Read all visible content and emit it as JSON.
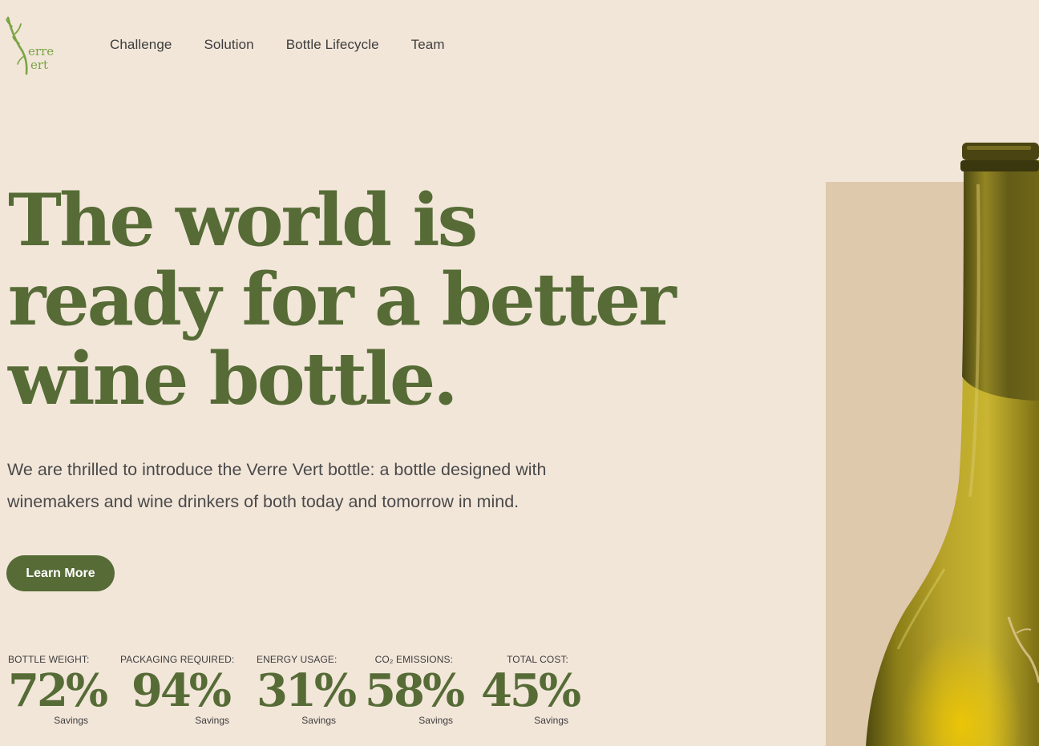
{
  "brand": {
    "name_line1": "erre",
    "name_line2": "ert",
    "accent_color": "#7aa343"
  },
  "nav": {
    "items": [
      {
        "label": "Challenge"
      },
      {
        "label": "Solution"
      },
      {
        "label": "Bottle Lifecycle"
      },
      {
        "label": "Team"
      }
    ]
  },
  "hero": {
    "headline_line1": "The world is",
    "headline_line2": "ready for a better",
    "headline_line3": "wine bottle.",
    "intro_line1": "We are thrilled to introduce the Verre Vert bottle: a bottle designed with",
    "intro_line2": "winemakers and wine drinkers of both today and tomorrow in mind.",
    "cta_label": "Learn More",
    "primary_color": "#566b36"
  },
  "stats": [
    {
      "label": "BOTTLE WEIGHT:",
      "value": "72%",
      "sub": "Savings"
    },
    {
      "label": "PACKAGING REQUIRED:",
      "value": "94%",
      "sub": "Savings"
    },
    {
      "label": "ENERGY USAGE:",
      "value": "31%",
      "sub": "Savings"
    },
    {
      "label": "CO₂ EMISSIONS:",
      "value": "58%",
      "sub": "Savings"
    },
    {
      "label": "TOTAL COST:",
      "value": "45%",
      "sub": "Savings"
    }
  ],
  "colors": {
    "background": "#f2e6d9",
    "panel": "#dec9ad",
    "bottle_glass": "#9a8a1c"
  }
}
